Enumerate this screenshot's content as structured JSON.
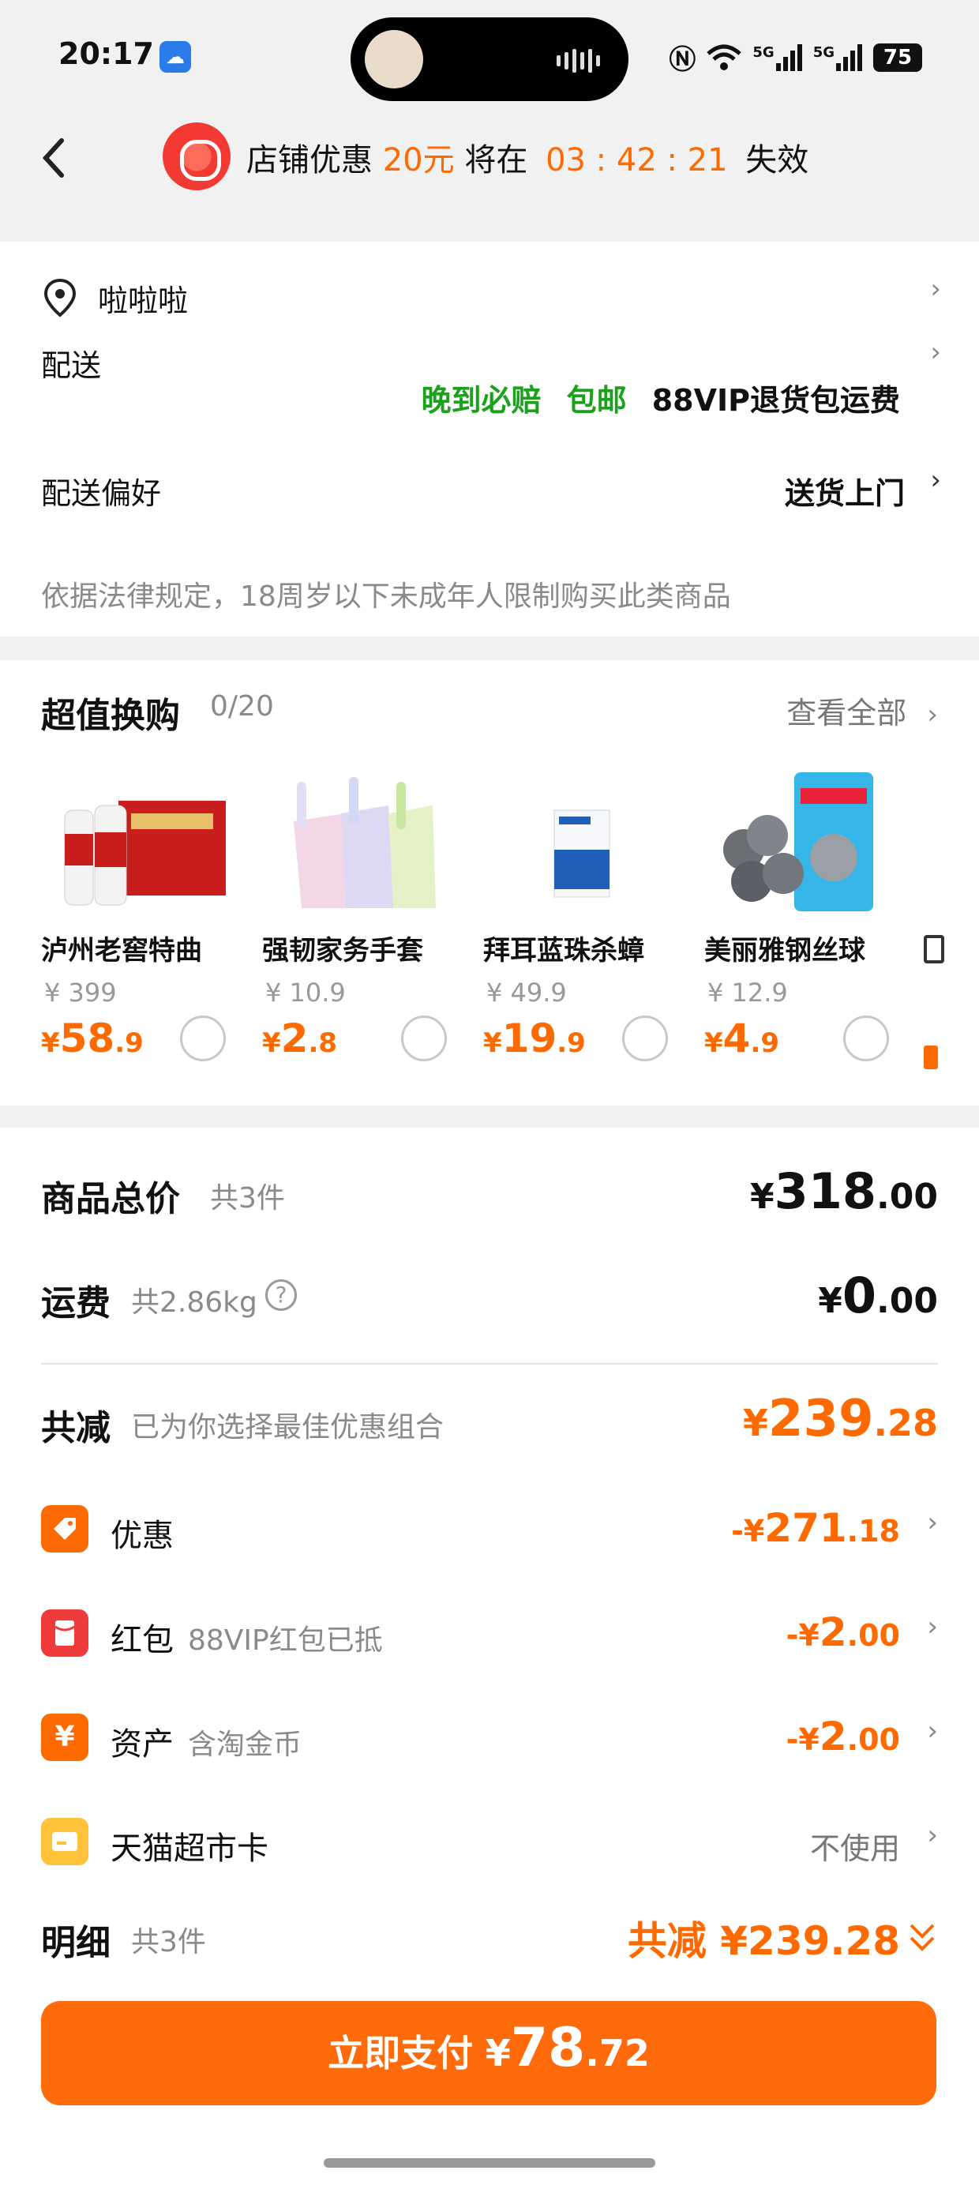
{
  "status_bar": {
    "time": "20:17",
    "network1": "5G",
    "network2": "5G",
    "battery": "75"
  },
  "banner": {
    "prefix": "店铺优惠",
    "amount": "20元",
    "middle": "将在",
    "countdown": "03 : 42 : 21",
    "suffix": "失效"
  },
  "address": {
    "name": "啦啦啦"
  },
  "delivery": {
    "label": "配送",
    "tag1": "晚到必赔",
    "tag2": "包邮",
    "tag3": "88VIP退货包运费"
  },
  "preference": {
    "label": "配送偏好",
    "value": "送货上门"
  },
  "notice": "依据法律规定，18周岁以下未成年人限制购买此类商品",
  "exchange": {
    "title": "超值换购",
    "count": "0/20",
    "view_all": "查看全部",
    "items": [
      {
        "name": "泸州老窖特曲",
        "old": "¥ 399",
        "cur": "¥",
        "int": "58",
        "dec": ".9"
      },
      {
        "name": "强韧家务手套",
        "old": "¥ 10.9",
        "cur": "¥",
        "int": "2",
        "dec": ".8"
      },
      {
        "name": "拜耳蓝珠杀蟑",
        "old": "¥ 49.9",
        "cur": "¥",
        "int": "19",
        "dec": ".9"
      },
      {
        "name": "美丽雅钢丝球",
        "old": "¥ 12.9",
        "cur": "¥",
        "int": "4",
        "dec": ".9"
      }
    ]
  },
  "summary": {
    "total_label": "商品总价",
    "total_count": "共3件",
    "total_cur": "¥",
    "total_int": "318",
    "total_dec": ".00",
    "ship_label": "运费",
    "ship_weight": "共2.86kg",
    "ship_cur": "¥",
    "ship_int": "0",
    "ship_dec": ".00",
    "reduce_label": "共减",
    "reduce_note": "已为你选择最佳优惠组合",
    "reduce_cur": "¥",
    "reduce_int": "239",
    "reduce_dec": ".28"
  },
  "discounts": [
    {
      "label": "优惠",
      "note": "",
      "pre": "-¥",
      "int": "271",
      "dec": ".18",
      "color": "#ff6a00"
    },
    {
      "label": "红包",
      "note": "88VIP红包已抵",
      "pre": "-¥",
      "int": "2",
      "dec": ".00",
      "color": "#ef3b3b"
    },
    {
      "label": "资产",
      "note": "含淘金币",
      "pre": "-¥",
      "int": "2",
      "dec": ".00",
      "color": "#ff6a00"
    },
    {
      "label": "天猫超市卡",
      "note": "",
      "value": "不使用",
      "color": "#ffc23a"
    }
  ],
  "detail": {
    "label": "明细",
    "count": "共3件",
    "reduce_text": "共减 ¥239.28"
  },
  "pay": {
    "label": "立即支付",
    "cur": "¥",
    "int": "78",
    "dec": ".72"
  }
}
